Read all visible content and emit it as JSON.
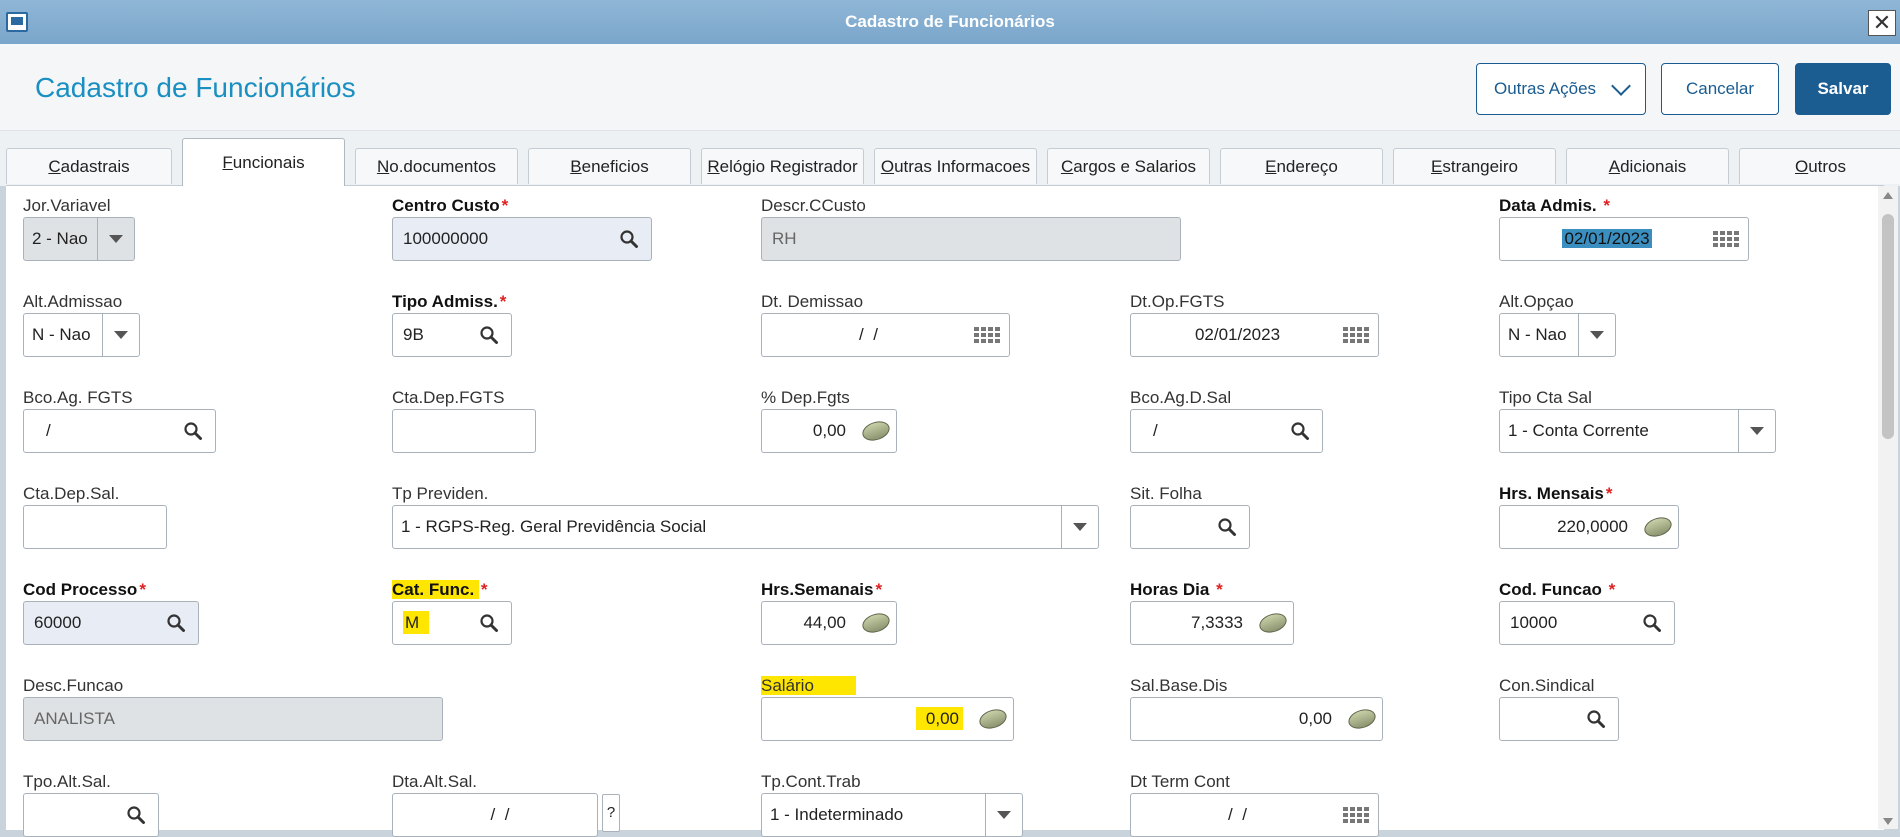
{
  "window": {
    "title": "Cadastro de Funcionários",
    "close_glyph": "✕"
  },
  "header": {
    "title": "Cadastro de Funcionários",
    "other_actions": "Outras Ações",
    "cancel": "Cancelar",
    "save": "Salvar"
  },
  "tabs": [
    {
      "label": "Cadastrais",
      "key": "C",
      "rest": "adastrais"
    },
    {
      "label": "Funcionais",
      "key": "F",
      "rest": "uncionais"
    },
    {
      "label": "No.documentos",
      "key": "N",
      "rest": "o.documentos"
    },
    {
      "label": "Beneficios",
      "key": "B",
      "rest": "eneficios"
    },
    {
      "label": "Relógio Registrador",
      "key": "R",
      "rest": "elógio Registrador"
    },
    {
      "label": "Outras Informacoes",
      "key": "O",
      "rest": "utras Informacoes"
    },
    {
      "label": "Cargos e Salarios",
      "key": "C",
      "rest": "argos e Salarios"
    },
    {
      "label": "Endereço",
      "key": "E",
      "rest": "ndereço"
    },
    {
      "label": "Estrangeiro",
      "key": "E",
      "rest": "strangeiro"
    },
    {
      "label": "Adicionais",
      "key": "A",
      "rest": "dicionais"
    },
    {
      "label": "Outros",
      "key": "O",
      "rest": "utros"
    }
  ],
  "active_tab": "Funcionais",
  "fields": {
    "jor_variavel": {
      "label": "Jor.Variavel",
      "value": "2 - Nao"
    },
    "centro_custo": {
      "label": "Centro Custo",
      "required": "*",
      "value": "100000000"
    },
    "descr_ccusto": {
      "label": "Descr.CCusto",
      "value": "RH"
    },
    "data_adms": {
      "label": "Data Admis. ",
      "required": "*",
      "value": "02/01/2023"
    },
    "alt_admissao": {
      "label": "Alt.Admissao",
      "value": "N - Nao"
    },
    "tipo_admiss": {
      "label": "Tipo Admiss.",
      "required": "*",
      "value": "9B"
    },
    "dt_demissao": {
      "label": "Dt. Demissao",
      "value": "/  /"
    },
    "dt_op_fgts": {
      "label": "Dt.Op.FGTS",
      "value": "02/01/2023"
    },
    "alt_opcao": {
      "label": "Alt.Opçao",
      "value": "N - Nao"
    },
    "bco_ag_fgts": {
      "label": "Bco.Ag. FGTS",
      "value": "/"
    },
    "cta_dep_fgts": {
      "label": "Cta.Dep.FGTS",
      "value": ""
    },
    "pct_dep_fgts": {
      "label": "% Dep.Fgts",
      "value": "0,00"
    },
    "bco_ag_d_sal": {
      "label": "Bco.Ag.D.Sal",
      "value": "/"
    },
    "tipo_cta_sal": {
      "label": "Tipo Cta Sal",
      "value": "1 - Conta Corrente"
    },
    "cta_dep_sal": {
      "label": "Cta.Dep.Sal.",
      "value": ""
    },
    "tp_previden": {
      "label": "Tp Previden.",
      "value": "1 - RGPS-Reg. Geral Previdência Social"
    },
    "sit_folha": {
      "label": "Sit. Folha",
      "value": ""
    },
    "hrs_mensais": {
      "label": "Hrs. Mensais",
      "required": "*",
      "value": "220,0000"
    },
    "cod_processo": {
      "label": "Cod Processo",
      "required": "*",
      "value": "60000"
    },
    "cat_func": {
      "label": "Cat. Func. ",
      "required": "*",
      "value": "M"
    },
    "hrs_semanais": {
      "label": "Hrs.Semanais",
      "required": "*",
      "value": "44,00"
    },
    "horas_dia": {
      "label": "Horas Dia ",
      "required": "*",
      "value": "7,3333"
    },
    "cod_funcao": {
      "label": "Cod. Funcao ",
      "required": "*",
      "value": "10000"
    },
    "desc_funcao": {
      "label": "Desc.Funcao",
      "value": "ANALISTA"
    },
    "salario": {
      "label": "Salário",
      "value": "0,00"
    },
    "sal_base_dis": {
      "label": "Sal.Base.Dis",
      "value": "0,00"
    },
    "con_sindical": {
      "label": "Con.Sindical",
      "value": ""
    },
    "tpo_alt_sal": {
      "label": "Tpo.Alt.Sal.",
      "value": ""
    },
    "dta_alt_sal": {
      "label": "Dta.Alt.Sal.",
      "value": "/  /",
      "help": "?"
    },
    "tp_cont_trab": {
      "label": "Tp.Cont.Trab",
      "value": "1 - Indeterminado"
    },
    "dt_term_cont": {
      "label": "Dt Term Cont",
      "value": "/  /"
    }
  },
  "highlight_color": "#ffe600",
  "accent_color": "#1b5c91",
  "title_color": "#1a8fc1"
}
